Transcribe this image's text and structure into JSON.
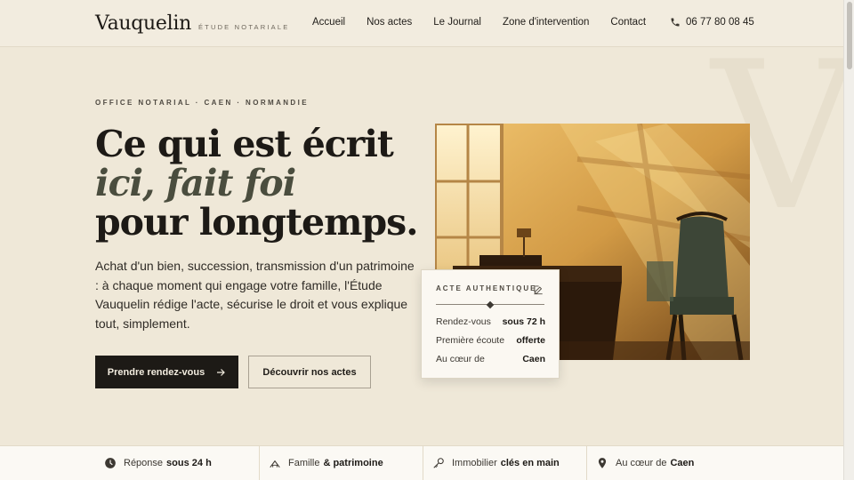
{
  "brand": {
    "name": "Vauquelin",
    "tagline": "ÉTUDE NOTARIALE"
  },
  "nav": {
    "items": [
      {
        "label": "Accueil"
      },
      {
        "label": "Nos actes"
      },
      {
        "label": "Le Journal"
      },
      {
        "label": "Zone d'intervention"
      },
      {
        "label": "Contact"
      }
    ],
    "phone": "06 77 80 08 45",
    "phone_icon": "phone-icon"
  },
  "watermark": "V",
  "hero": {
    "eyebrow": "OFFICE NOTARIAL · CAEN · NORMANDIE",
    "headline_line1": "Ce qui est écrit",
    "headline_accent": "ici, fait foi",
    "headline_line3": "pour longtemps.",
    "lead": "Achat d'un bien, succession, transmission d'un patrimoine : à chaque moment qui engage votre famille, l'Étude Vauquelin rédige l'acte, sécurise le droit et vous explique tout, simplement.",
    "primary_button": "Prendre rendez-vous",
    "secondary_button": "Découvrir nos actes"
  },
  "card": {
    "title": "ACTE AUTHENTIQUE",
    "icon": "signature-icon",
    "rows": [
      {
        "key": "Rendez-vous",
        "value": "sous 72 h"
      },
      {
        "key": "Première écoute",
        "value": "offerte"
      },
      {
        "key": "Au cœur de",
        "value": "Caen"
      }
    ]
  },
  "strip": [
    {
      "icon": "clock-icon",
      "text": "Réponse",
      "strong": "sous 24 h"
    },
    {
      "icon": "family-icon",
      "text": "Famille",
      "strong": "& patrimoine"
    },
    {
      "icon": "key-icon",
      "text": "Immobilier",
      "strong": "clés en main"
    },
    {
      "icon": "location-pin-icon",
      "text": "Au cœur de",
      "strong": "Caen"
    }
  ],
  "colors": {
    "background": "#efe8d8",
    "ink": "#1d1a16",
    "accent_olive": "#4a4d3e"
  }
}
